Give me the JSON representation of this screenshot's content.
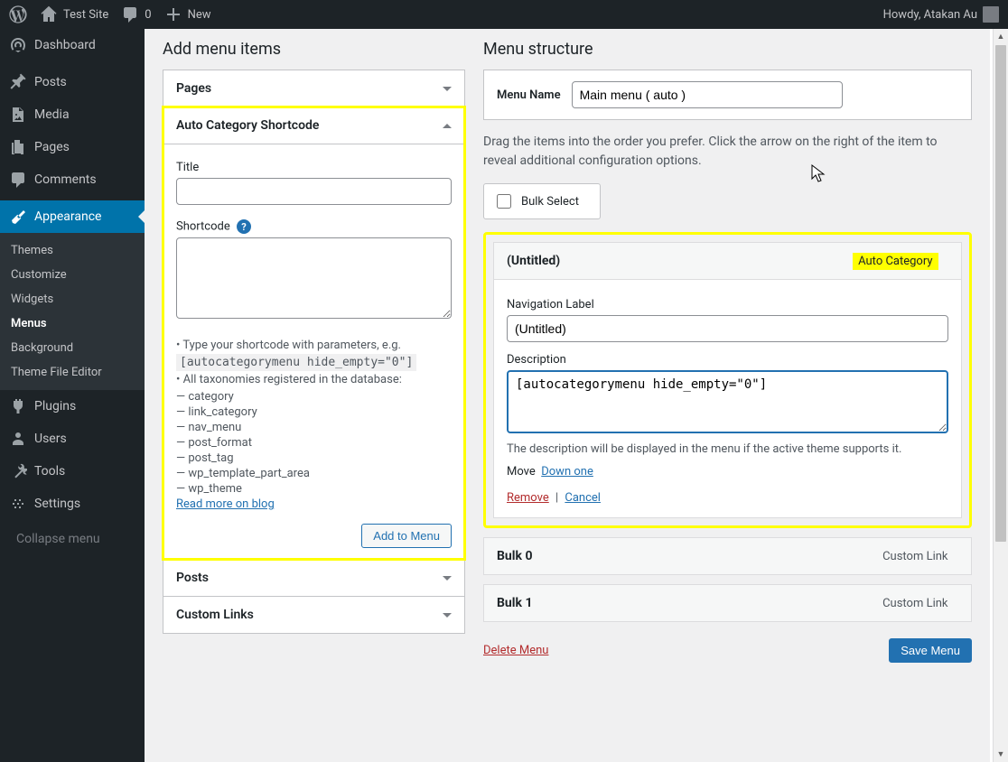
{
  "adminbar": {
    "site": "Test Site",
    "comments": "0",
    "new": "New",
    "howdy": "Howdy, Atakan Au"
  },
  "sidebar": {
    "items": [
      {
        "id": "dashboard",
        "label": "Dashboard"
      },
      {
        "id": "posts",
        "label": "Posts"
      },
      {
        "id": "media",
        "label": "Media"
      },
      {
        "id": "pages",
        "label": "Pages"
      },
      {
        "id": "comments",
        "label": "Comments"
      },
      {
        "id": "appearance",
        "label": "Appearance"
      },
      {
        "id": "plugins",
        "label": "Plugins"
      },
      {
        "id": "users",
        "label": "Users"
      },
      {
        "id": "tools",
        "label": "Tools"
      },
      {
        "id": "settings",
        "label": "Settings"
      }
    ],
    "submenu": [
      {
        "label": "Themes"
      },
      {
        "label": "Customize"
      },
      {
        "label": "Widgets"
      },
      {
        "label": "Menus",
        "current": true
      },
      {
        "label": "Background"
      },
      {
        "label": "Theme File Editor"
      }
    ],
    "collapse": "Collapse menu"
  },
  "left": {
    "heading": "Add menu items",
    "pages": "Pages",
    "acs": {
      "title": "Auto Category Shortcode",
      "title_label": "Title",
      "shortcode_label": "Shortcode",
      "hint1": "• Type your shortcode with parameters, e.g.",
      "code": "[autocategorymenu hide_empty=\"0\"]",
      "hint2": "• All taxonomies registered in the database:",
      "taxonomies": [
        "— category",
        "— link_category",
        "— nav_menu",
        "— post_format",
        "— post_tag",
        "— wp_template_part_area",
        "— wp_theme"
      ],
      "read_more": "Read more on blog",
      "add_btn": "Add to Menu"
    },
    "posts": "Posts",
    "custom_links": "Custom Links"
  },
  "right": {
    "heading": "Menu structure",
    "menu_name_label": "Menu Name",
    "menu_name_value": "Main menu ( auto )",
    "instructions": "Drag the items into the order you prefer. Click the arrow on the right of the item to reveal additional configuration options.",
    "bulk_select": "Bulk Select",
    "expanded": {
      "title": "(Untitled)",
      "type": "Auto Category",
      "nav_label": "Navigation Label",
      "nav_value": "(Untitled)",
      "desc_label": "Description",
      "desc_value": "[autocategorymenu hide_empty=\"0\"]",
      "desc_hint": "The description will be displayed in the menu if the active theme supports it.",
      "move": "Move",
      "down_one": "Down one",
      "remove": "Remove",
      "cancel": "Cancel"
    },
    "items": [
      {
        "title": "Bulk 0",
        "type": "Custom Link"
      },
      {
        "title": "Bulk 1",
        "type": "Custom Link"
      }
    ],
    "delete_menu": "Delete Menu",
    "save_menu": "Save Menu"
  }
}
